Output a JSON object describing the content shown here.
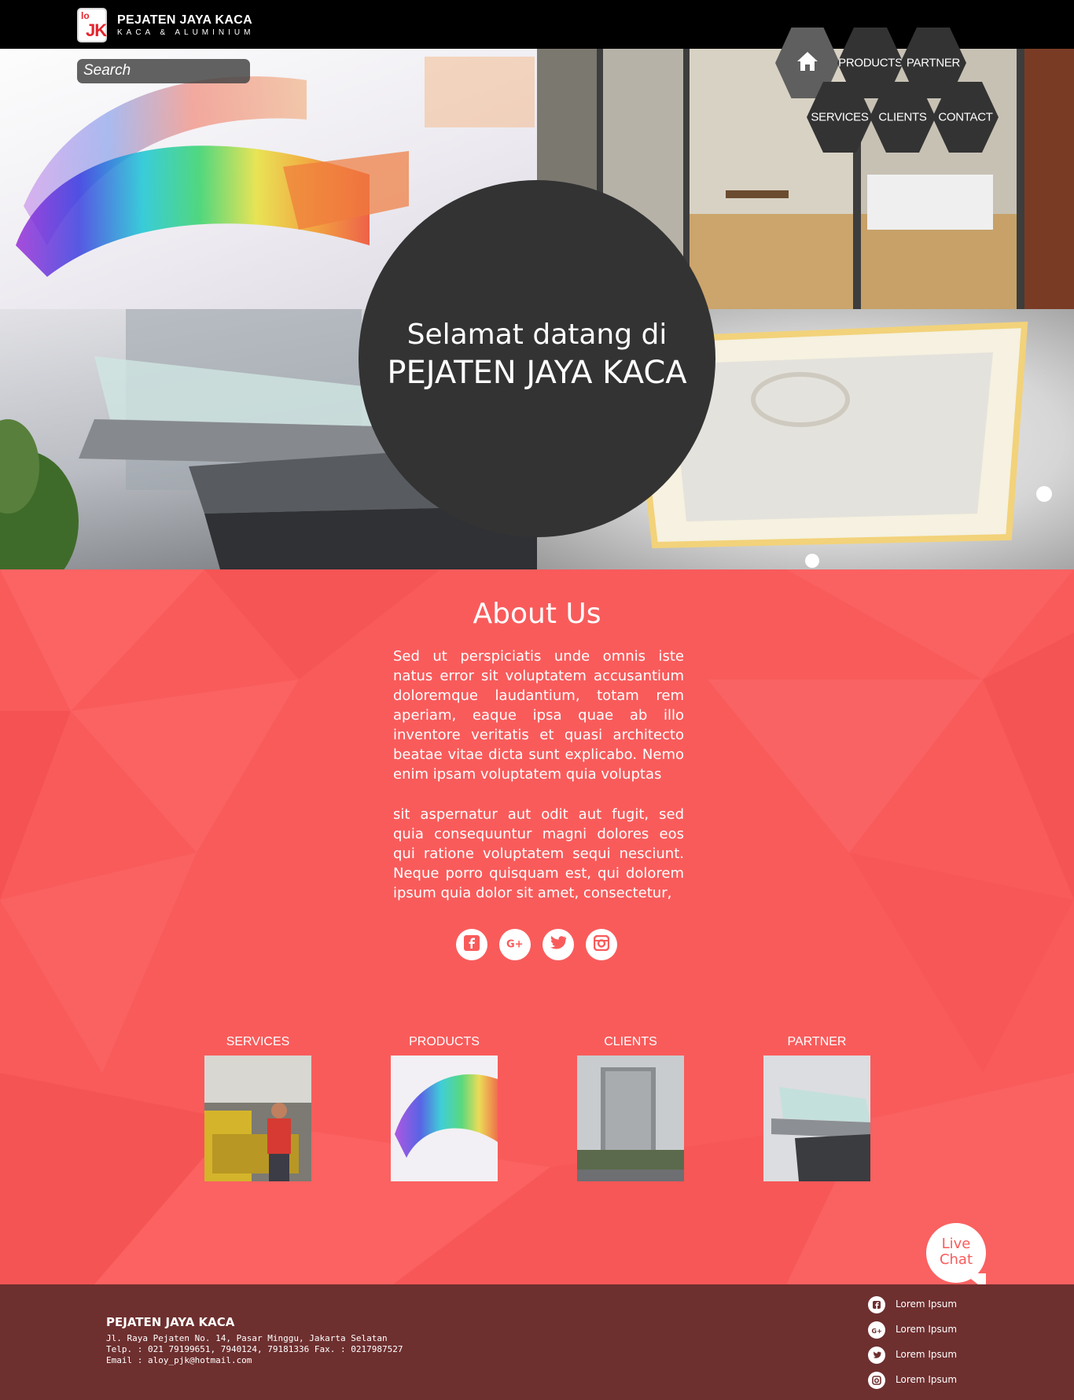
{
  "header": {
    "logo_text_top": "lo",
    "logo_text_main": "JK",
    "brand_name": "PEJATEN JAYA KACA",
    "brand_tagline": "KACA & ALUMINIUM"
  },
  "search": {
    "label": "Search"
  },
  "nav": {
    "home_icon": "home-icon",
    "items": [
      "PRODUCTS",
      "PARTNER",
      "SERVICES",
      "CLIENTS",
      "CONTACT"
    ]
  },
  "hero": {
    "welcome_line1": "Selamat datang di",
    "welcome_line2": "PEJATEN JAYA KACA"
  },
  "about": {
    "title": "About Us",
    "paragraph1": "Sed ut perspiciatis unde omnis iste natus error sit voluptatem accusantium doloremque laudantium, totam rem aperiam, eaque ipsa quae ab illo inventore veritatis et quasi architecto beatae vitae dicta sunt explicabo. Nemo enim ipsam voluptatem quia voluptas",
    "paragraph2": "sit aspernatur aut odit aut fugit, sed quia consequuntur magni dolores eos qui ratione voluptatem sequi nesciunt. Neque porro quisquam est, qui dolorem ipsum quia dolor sit amet, consectetur,",
    "social_icons": [
      "facebook-icon",
      "google-plus-icon",
      "twitter-icon",
      "instagram-icon"
    ]
  },
  "categories": [
    {
      "label": "SERVICES"
    },
    {
      "label": "PRODUCTS"
    },
    {
      "label": "CLIENTS"
    },
    {
      "label": "PARTNER"
    }
  ],
  "live_chat": {
    "line1": "Live",
    "line2": "Chat"
  },
  "footer": {
    "company": "PEJATEN JAYA KACA",
    "address": "Jl. Raya Pejaten No. 14, Pasar Minggu, Jakarta Selatan",
    "phone": "Telp. : 021 79199651, 7940124, 79181336 Fax. : 0217987527",
    "email": "Email : aloy_pjk@hotmail.com",
    "social": [
      {
        "icon": "facebook-icon",
        "label": "Lorem Ipsum"
      },
      {
        "icon": "google-plus-icon",
        "label": "Lorem Ipsum"
      },
      {
        "icon": "twitter-icon",
        "label": "Lorem Ipsum"
      },
      {
        "icon": "instagram-icon",
        "label": "Lorem Ipsum"
      }
    ]
  },
  "colors": {
    "header_bg": "#000000",
    "circle_bg": "#333333",
    "about_bg": "#f95b5b",
    "footer_bg": "#6e2f2f"
  }
}
